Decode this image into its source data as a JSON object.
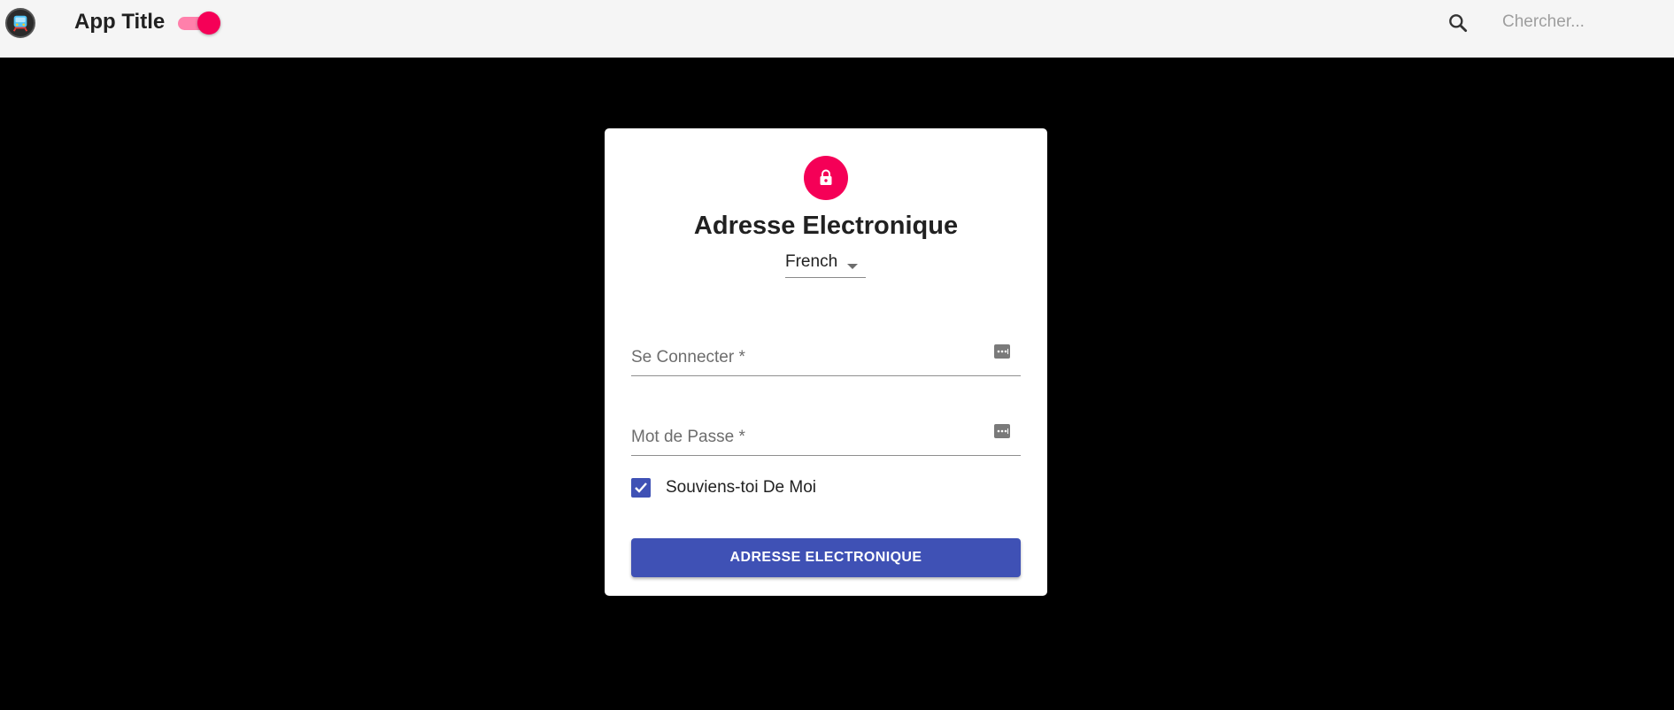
{
  "appbar": {
    "title": "App Title",
    "logo_icon": "subway-icon",
    "dark_mode_toggle": {
      "on": true,
      "track_color": "#ff80ab",
      "thumb_color": "#f50057"
    },
    "search": {
      "icon": "search-icon",
      "placeholder": "Chercher..."
    }
  },
  "login_card": {
    "avatar_icon": "lock-icon",
    "title": "Adresse Electronique",
    "language": {
      "selected": "French",
      "icon": "arrow-drop-down-icon"
    },
    "fields": {
      "login": {
        "label": "Se Connecter *",
        "value": "",
        "icon": "password-dots-icon"
      },
      "password": {
        "label": "Mot de Passe *",
        "value": "",
        "icon": "password-dots-icon"
      }
    },
    "remember_me": {
      "label": "Souviens-toi De Moi",
      "checked": true
    },
    "submit_label": "ADRESSE ELECTRONIQUE"
  },
  "colors": {
    "appbar_bg": "#f5f5f5",
    "page_bg": "#000000",
    "accent_pink": "#f50057",
    "primary_indigo": "#3f51b5"
  }
}
